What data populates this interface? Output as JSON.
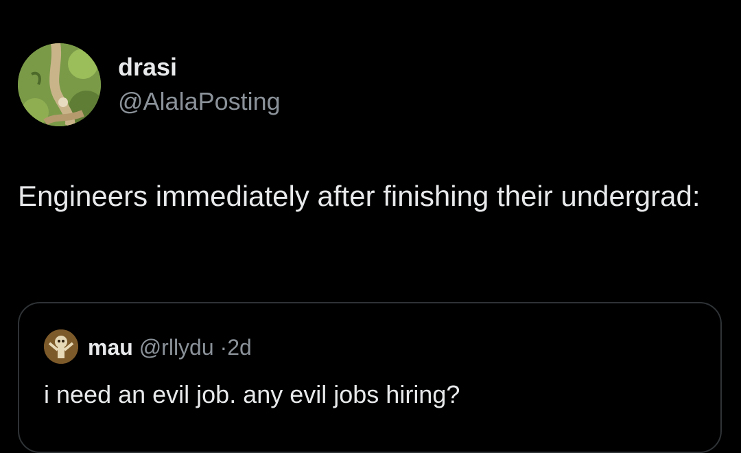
{
  "tweet": {
    "author": {
      "display_name": "drasi",
      "handle": "@AlalaPosting"
    },
    "text": "Engineers immediately after finishing their undergrad:"
  },
  "quoted_tweet": {
    "author": {
      "display_name": "mau",
      "handle": "@rllydu"
    },
    "separator": "·",
    "time": "2d",
    "text": "i need an evil job. any evil jobs hiring?"
  },
  "colors": {
    "background": "#000000",
    "primary_text": "#e7e9ea",
    "secondary_text": "#8b9299",
    "border": "#2f3336"
  }
}
